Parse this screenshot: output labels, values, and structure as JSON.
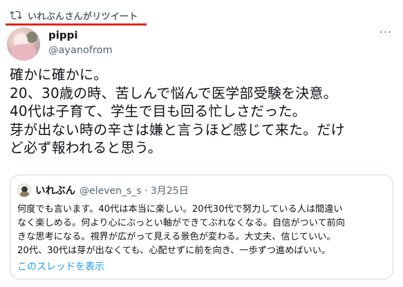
{
  "retweet": {
    "icon": "retweet-icon",
    "label": "いれぶんさんがリツイート",
    "underline_color": "#e0241b"
  },
  "tweet": {
    "avatar_icon": "avatar",
    "display_name": "pippi",
    "handle": "@ayanofrom",
    "more_icon": "more-icon",
    "more_label": "···",
    "lines": [
      "確かに確かに。",
      "20、30歳の時、苦しんで悩んで医学部受験を決意。",
      "40代は子育て、学生で目も回る忙しさだった。",
      "芽が出ない時の辛さは嫌と言うほど感じて来た。だけ",
      "ど必ず報われると思う。"
    ]
  },
  "quote": {
    "display_name": "いれぶん",
    "meta": "@eleven_s_s · 3月25日",
    "lines": [
      "何度でも言います。40代は本当に楽しい。20代30代で努力している人は間違い",
      "なく楽しめる。何より心にぶっとい軸ができてぶれなくなる。自信がついて前向",
      "きな思考になる。視界が広がって見える景色が変わる。大丈夫、信じていい。",
      "20代、30代は芽が出なくても、心配せずに前を向き、一歩ずつ進めばいい。"
    ],
    "thread_link": "このスレッドを表示"
  },
  "colors": {
    "text": "#0f1419",
    "secondary": "#536471",
    "link": "#1d9bf0",
    "border": "#cfd9de"
  }
}
